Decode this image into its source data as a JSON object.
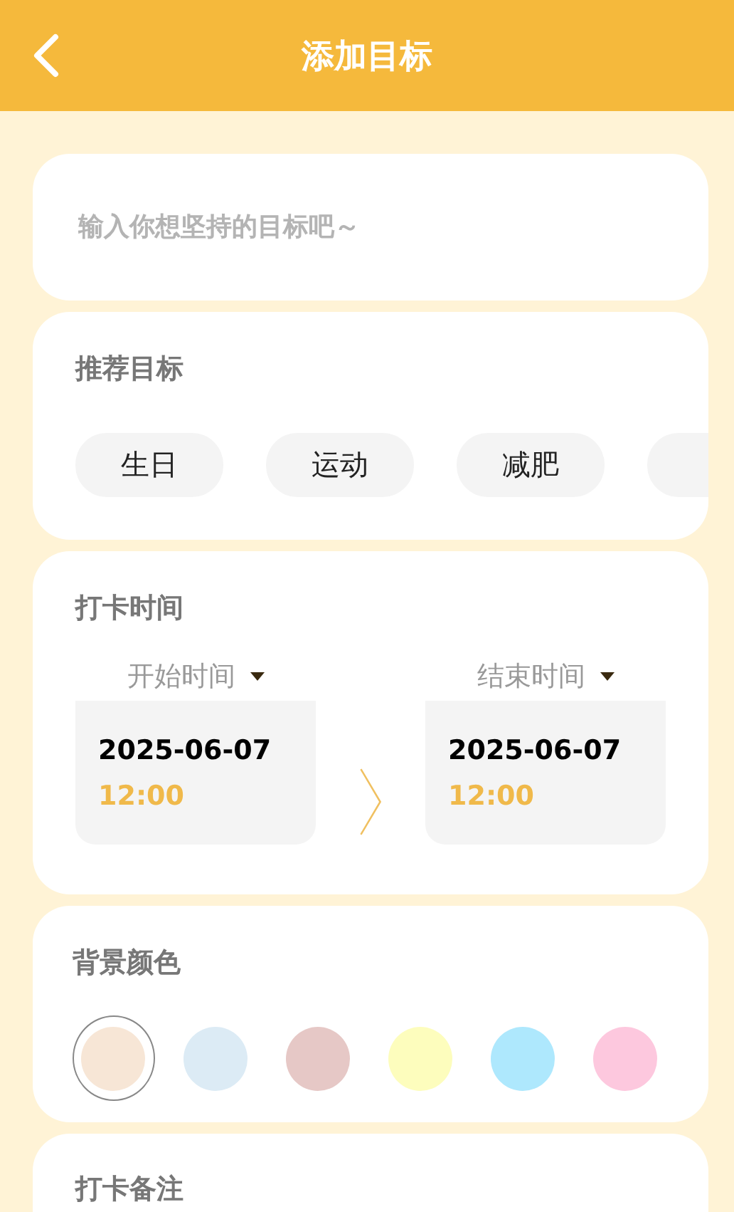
{
  "header": {
    "title": "添加目标"
  },
  "goal_input": {
    "placeholder": "输入你想坚持的目标吧～"
  },
  "recommend": {
    "title": "推荐目标",
    "chips": [
      "生日",
      "运动",
      "减肥"
    ]
  },
  "checkin_time": {
    "title": "打卡时间",
    "start": {
      "label": "开始时间",
      "date": "2025-06-07",
      "time": "12:00"
    },
    "end": {
      "label": "结束时间",
      "date": "2025-06-07",
      "time": "12:00"
    }
  },
  "background_color": {
    "title": "背景颜色",
    "swatches": [
      {
        "color": "#f7e6d6",
        "selected": true
      },
      {
        "color": "#dcebf5",
        "selected": false
      },
      {
        "color": "#e6c8c6",
        "selected": false
      },
      {
        "color": "#fdfdbd",
        "selected": false
      },
      {
        "color": "#aee8fd",
        "selected": false
      },
      {
        "color": "#fdc8de",
        "selected": false
      }
    ]
  },
  "note": {
    "title": "打卡备注"
  }
}
